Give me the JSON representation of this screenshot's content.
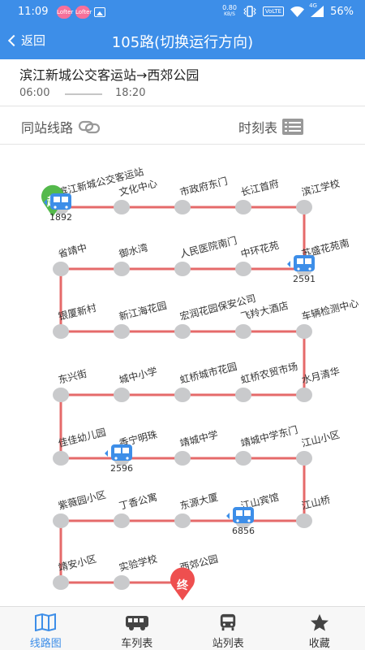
{
  "status_bar": {
    "time": "11:09",
    "app_badges": [
      "Lofter",
      "Lofter"
    ],
    "net_speed_value": "0.80",
    "net_speed_unit": "KB/S",
    "volte": "VoLTE",
    "network": "4G",
    "battery": "56%"
  },
  "header": {
    "back_label": "返回",
    "title": "105路(切换运行方向)"
  },
  "route": {
    "name": "滨江新城公交客运站→西郊公园",
    "first_time": "06:00",
    "last_time": "18:20"
  },
  "options": {
    "same_station_label": "同站线路",
    "schedule_label": "时刻表"
  },
  "map": {
    "start_marker": "起",
    "end_marker": "终",
    "stations": [
      "滨江新城公交客运站",
      "文化中心",
      "市政府东门",
      "长江首府",
      "滨江学校",
      "苏盛花苑南",
      "中环花苑",
      "人民医院南门",
      "御水湾",
      "省靖中",
      "银厦新村",
      "新江海花园",
      "宏润花园保安公司",
      "飞羚大酒店",
      "车辆检测中心",
      "水月清华",
      "虹桥农贸市场",
      "虹桥城市花园",
      "城中小学",
      "东兴街",
      "佳佳幼儿园",
      "香宁明珠",
      "靖城中学",
      "靖城中学东门",
      "江山小区",
      "江山桥",
      "江山宾馆",
      "东源大厦",
      "丁香公寓",
      "紫薇园小区",
      "靖安小区",
      "实验学校",
      "西郊公园"
    ],
    "buses": [
      {
        "plate": "1892",
        "station_index": 0
      },
      {
        "plate": "2591",
        "station_index": 5
      },
      {
        "plate": "2596",
        "station_index": 21
      },
      {
        "plate": "6856",
        "station_index": 26
      }
    ],
    "colors": {
      "route_line": "#e56a6a",
      "station_dot": "#c9cacc",
      "bus": "#3d8ee8",
      "start_marker": "#54b94b",
      "end_marker": "#ee4f4f"
    }
  },
  "bottom_nav": {
    "items": [
      {
        "label": "线路图",
        "icon": "map-book-icon",
        "active": true
      },
      {
        "label": "车列表",
        "icon": "bus-front-icon",
        "active": false
      },
      {
        "label": "站列表",
        "icon": "bus-side-icon",
        "active": false
      },
      {
        "label": "收藏",
        "icon": "star-icon",
        "active": false
      }
    ]
  }
}
